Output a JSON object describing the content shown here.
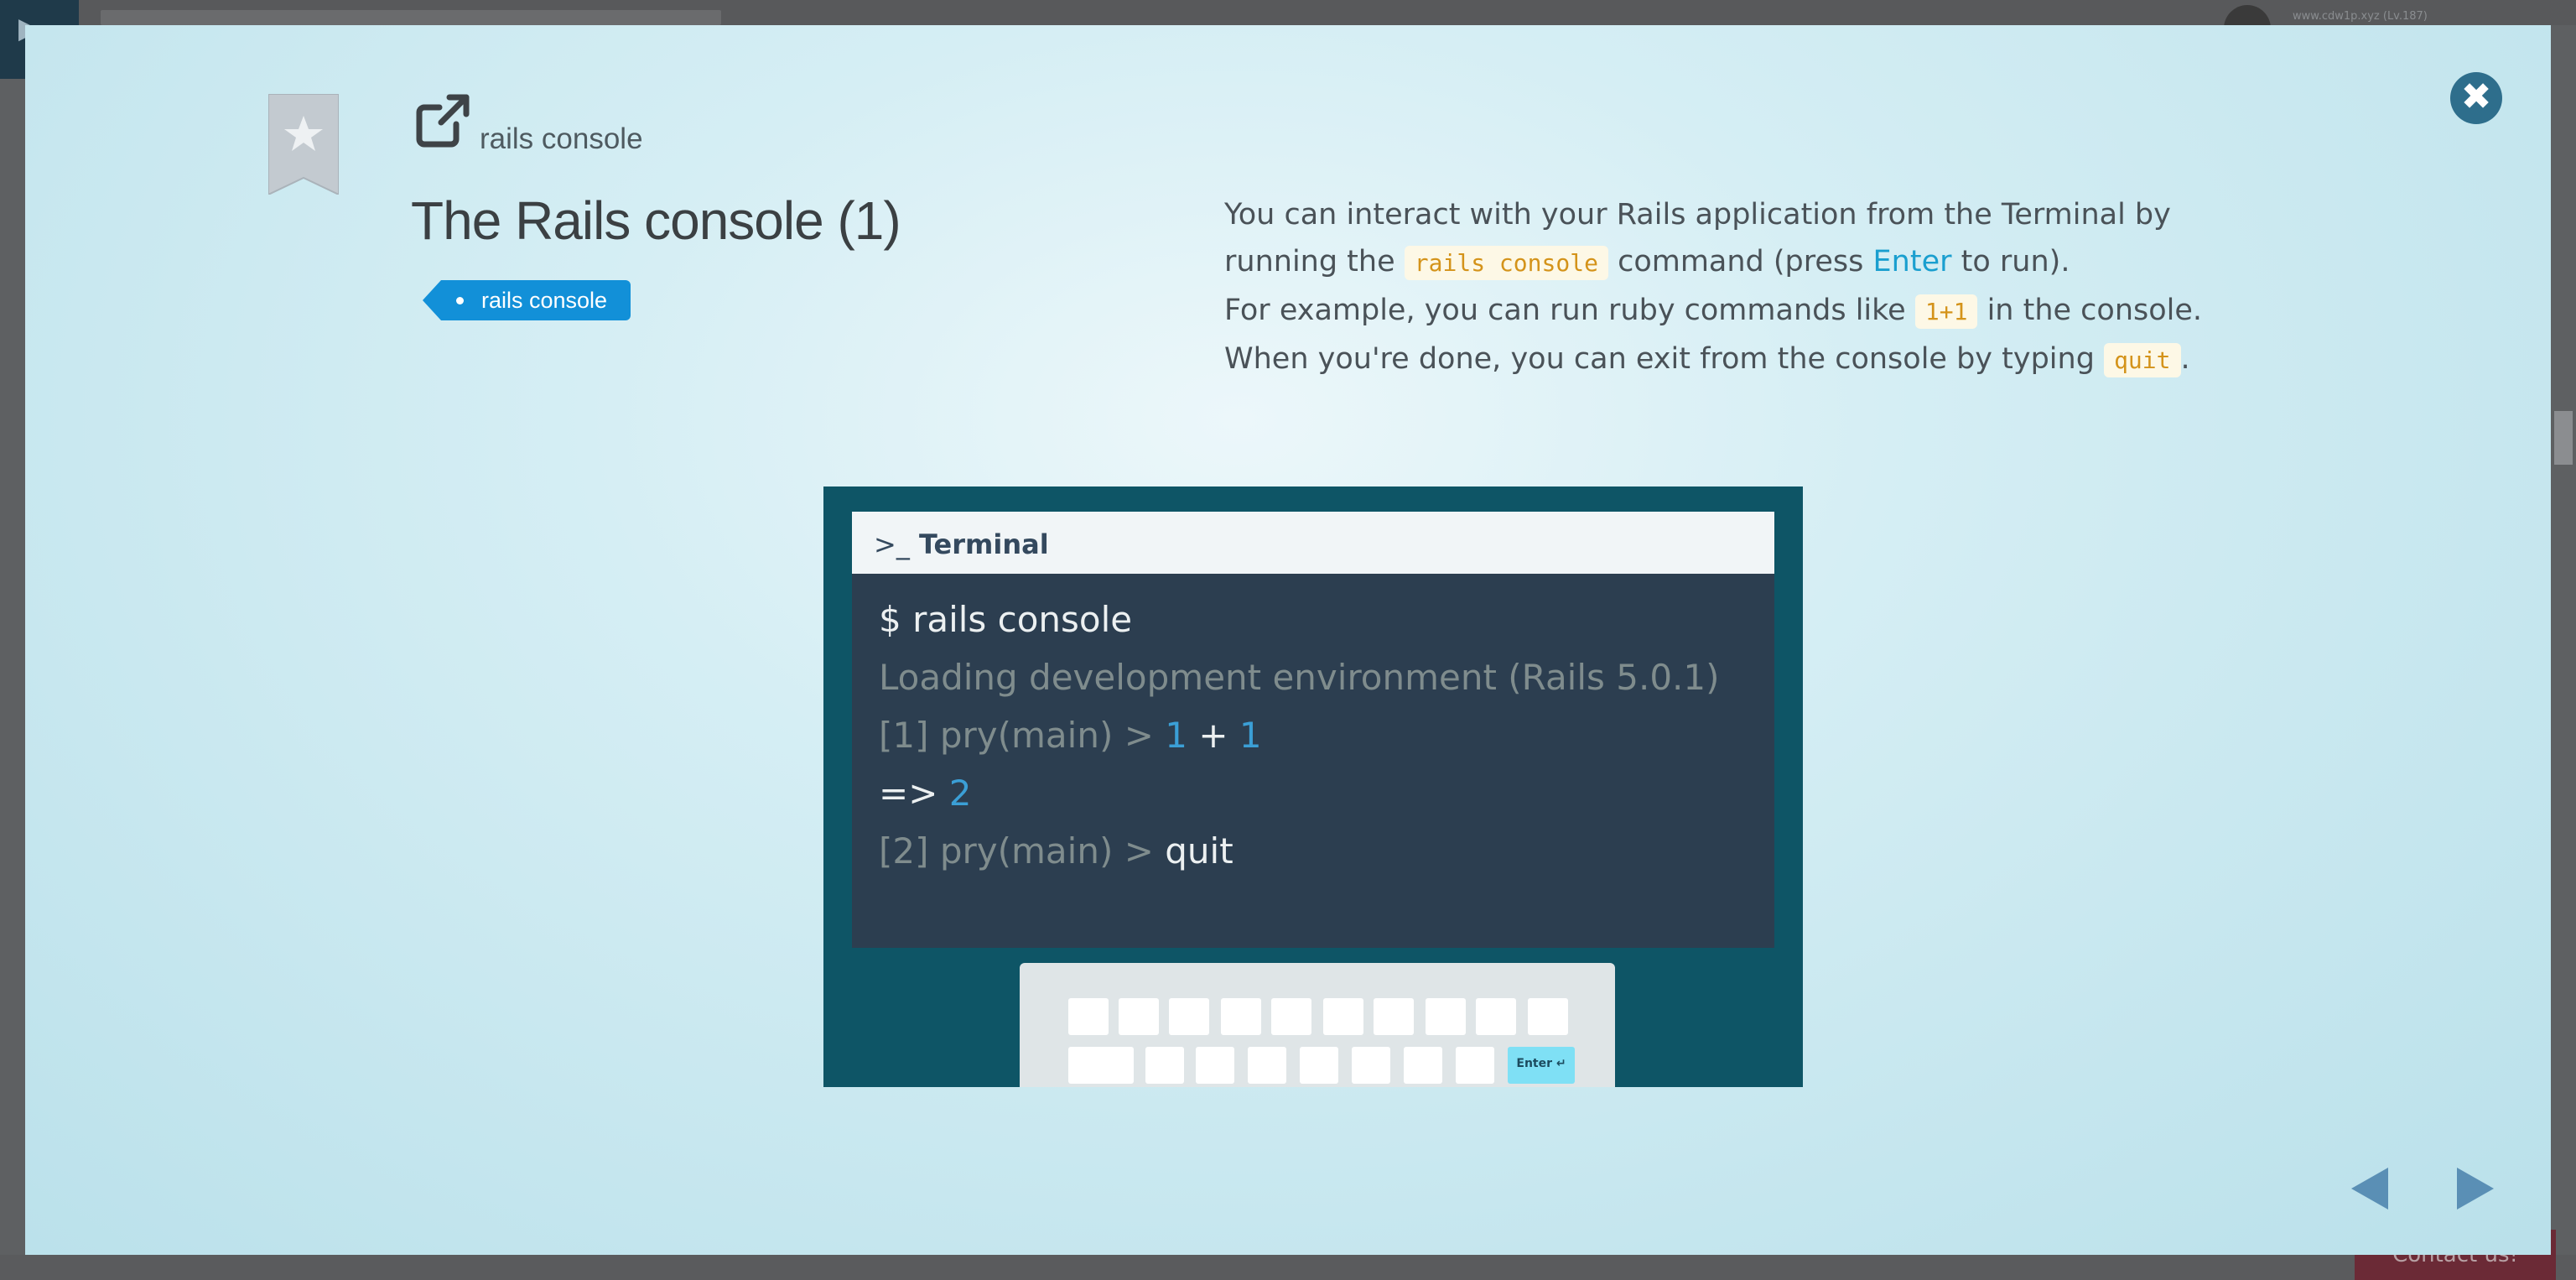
{
  "background": {
    "user_text": "www.cdw1p.xyz (Lv.187)",
    "contact_label": "Contact us!"
  },
  "modal": {
    "lesson_link": "rails console",
    "title": "The Rails console (1)",
    "tag": "rails console",
    "description": {
      "line1": "You can interact with your Rails application from the Terminal by",
      "line2_pre": "running the",
      "line2_code": "rails console",
      "line2_mid": "command (press",
      "line2_key": "Enter",
      "line2_post": "to run).",
      "line3_pre": "For example, you can run ruby commands like",
      "line3_code": "1+1",
      "line3_post": "in the console.",
      "line4_pre": "When you're done, you can exit from the console by typing",
      "line4_code": "quit",
      "line4_post": "."
    },
    "terminal": {
      "title": "Terminal",
      "prompt_icon": ">_",
      "line1": "$ rails console",
      "line2": "Loading development environment (Rails 5.0.1)",
      "line3_prompt": "[1] pry(main) >",
      "line3_a": "1",
      "line3_op": "+",
      "line3_b": "1",
      "line4_arrow": "=>",
      "line4_result": "2",
      "line5_prompt": "[2] pry(main) >",
      "line5_cmd": "quit"
    },
    "keyboard": {
      "enter_label": "Enter ↵"
    },
    "icons": {
      "close": "close-icon",
      "bookmark": "bookmark-star-icon",
      "external": "external-link-icon",
      "prev": "prev-arrow-icon",
      "next": "next-arrow-icon"
    },
    "colors": {
      "tag": "#1290d8",
      "close": "#2e6e8c",
      "terminal_bg": "#2c3e50",
      "illustration_bg": "#0e5566",
      "code_text": "#d4931a",
      "enter_highlight": "#1a9fcf"
    }
  }
}
